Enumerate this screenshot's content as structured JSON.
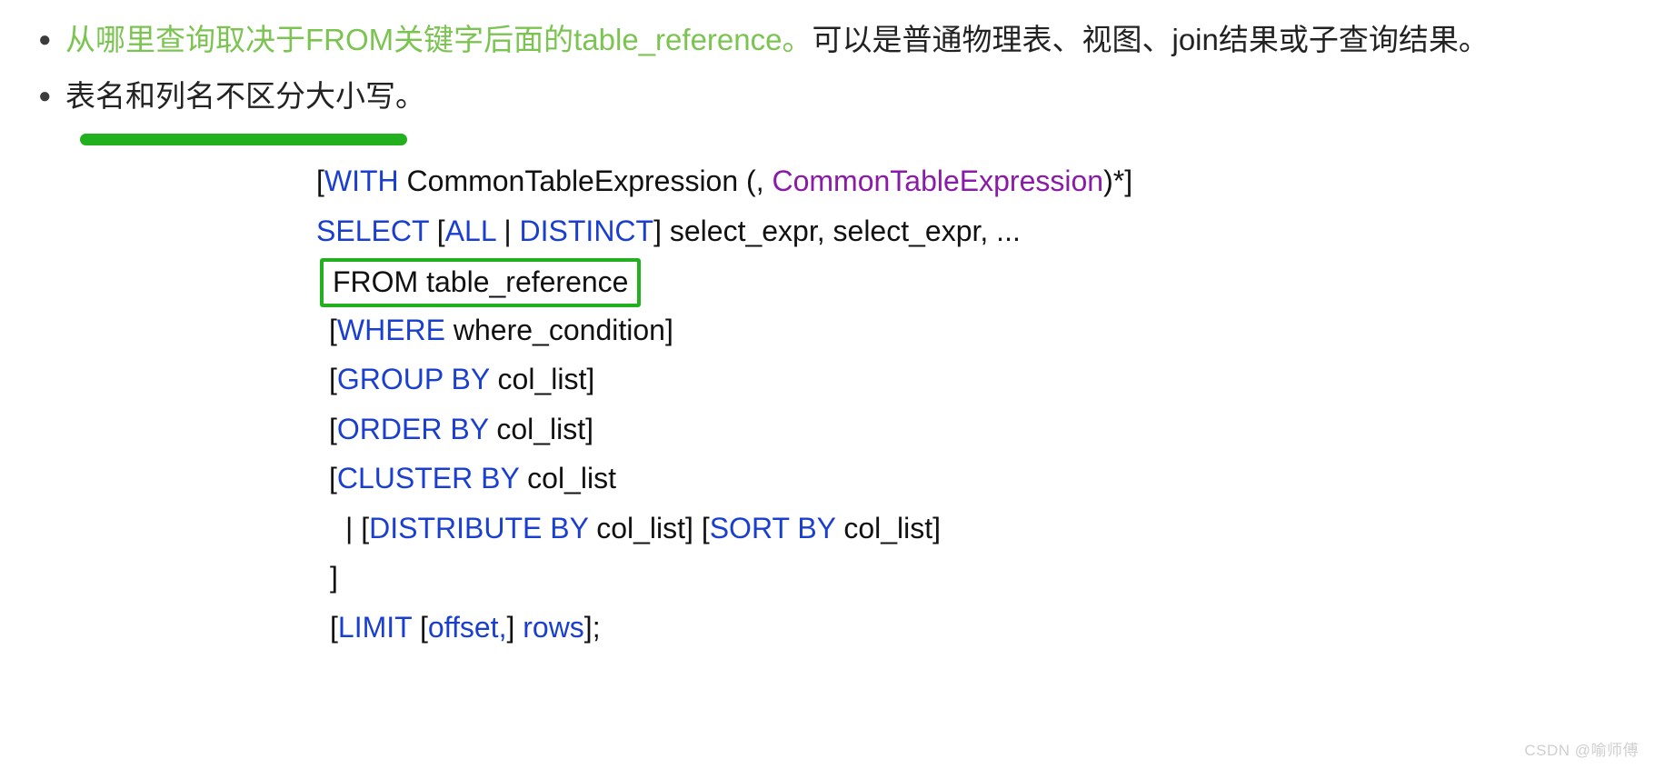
{
  "bullets": [
    {
      "marker": "●",
      "segments": [
        {
          "text": "从哪里查询取决于FROM关键字后面的table_reference。",
          "color": "green"
        },
        {
          "text": "可以是普通物理表、视图、join结果或子查询结果。",
          "color": "black"
        }
      ]
    },
    {
      "marker": "●",
      "segments": [
        {
          "text": "表名和列名不区分大小写。",
          "color": "black"
        }
      ],
      "underline": true
    }
  ],
  "sql": {
    "lines": [
      {
        "id": "with",
        "parts": [
          {
            "text": "[",
            "style": "blk"
          },
          {
            "text": "WITH",
            "style": "kw"
          },
          {
            "text": " CommonTableExpression (, ",
            "style": "blk"
          },
          {
            "text": "CommonTableExpression",
            "style": "pur"
          },
          {
            "text": ")*]",
            "style": "blk"
          }
        ]
      },
      {
        "id": "select",
        "parts": [
          {
            "text": "SELECT",
            "style": "kw"
          },
          {
            "text": " [",
            "style": "blk"
          },
          {
            "text": "ALL",
            "style": "kw"
          },
          {
            "text": " | ",
            "style": "blk"
          },
          {
            "text": "DISTINCT",
            "style": "kw"
          },
          {
            "text": "] select_expr, select_expr, ...",
            "style": "blk"
          }
        ]
      },
      {
        "id": "from",
        "boxed": true,
        "parts": [
          {
            "text": "FROM table_reference",
            "style": "blk"
          }
        ]
      },
      {
        "id": "where",
        "parts": [
          {
            "text": "[",
            "style": "blk"
          },
          {
            "text": "WHERE",
            "style": "kw"
          },
          {
            "text": " where_condition]",
            "style": "blk"
          }
        ]
      },
      {
        "id": "group-by",
        "parts": [
          {
            "text": "[",
            "style": "blk"
          },
          {
            "text": "GROUP BY",
            "style": "kw"
          },
          {
            "text": " col_list]",
            "style": "blk"
          }
        ]
      },
      {
        "id": "order-by",
        "parts": [
          {
            "text": "[",
            "style": "blk"
          },
          {
            "text": "ORDER BY",
            "style": "kw"
          },
          {
            "text": " col_list]",
            "style": "blk"
          }
        ]
      },
      {
        "id": "cluster-by",
        "parts": [
          {
            "text": "[",
            "style": "blk"
          },
          {
            "text": "CLUSTER BY",
            "style": "kw"
          },
          {
            "text": " col_list",
            "style": "blk"
          }
        ]
      },
      {
        "id": "distribute-sort-by",
        "parts": [
          {
            "text": "| [",
            "style": "blk"
          },
          {
            "text": "DISTRIBUTE BY",
            "style": "kw"
          },
          {
            "text": " col_list] [",
            "style": "blk"
          },
          {
            "text": "SORT BY",
            "style": "kw"
          },
          {
            "text": " col_list]",
            "style": "blk"
          }
        ]
      },
      {
        "id": "close-bracket",
        "parts": [
          {
            "text": "]",
            "style": "blk"
          }
        ]
      },
      {
        "id": "limit",
        "parts": [
          {
            "text": "[",
            "style": "blk"
          },
          {
            "text": "LIMIT",
            "style": "kw"
          },
          {
            "text": " [",
            "style": "blk"
          },
          {
            "text": "offset,",
            "style": "kw"
          },
          {
            "text": "] ",
            "style": "blk"
          },
          {
            "text": "rows",
            "style": "kw"
          },
          {
            "text": "];",
            "style": "blk"
          }
        ]
      }
    ]
  },
  "watermark": {
    "text": "CSDN @喻师傅"
  },
  "colors": {
    "keyword_blue": "#1a3fd0",
    "cte_purple": "#8a1ba8",
    "highlight_green": "#22b01f",
    "text_green": "#7cc451",
    "body_black": "#222222",
    "watermark_gray": "#cfcfcf"
  }
}
